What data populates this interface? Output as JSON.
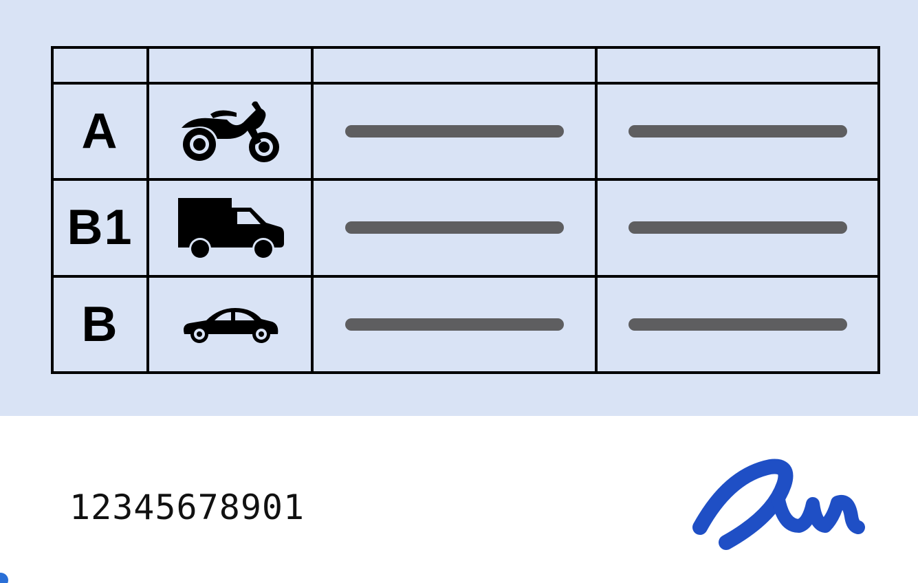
{
  "colors": {
    "panel_bg": "#d9e3f5",
    "grid_border": "#000000",
    "placeholder_line": "#5e5e60",
    "signature": "#1f4fc5"
  },
  "categories": [
    {
      "code": "A",
      "icon": "motorcycle-icon"
    },
    {
      "code": "B1",
      "icon": "truck-icon"
    },
    {
      "code": "B",
      "icon": "car-icon"
    }
  ],
  "license": {
    "number": "12345678901",
    "signature_icon": "signature-icon"
  }
}
